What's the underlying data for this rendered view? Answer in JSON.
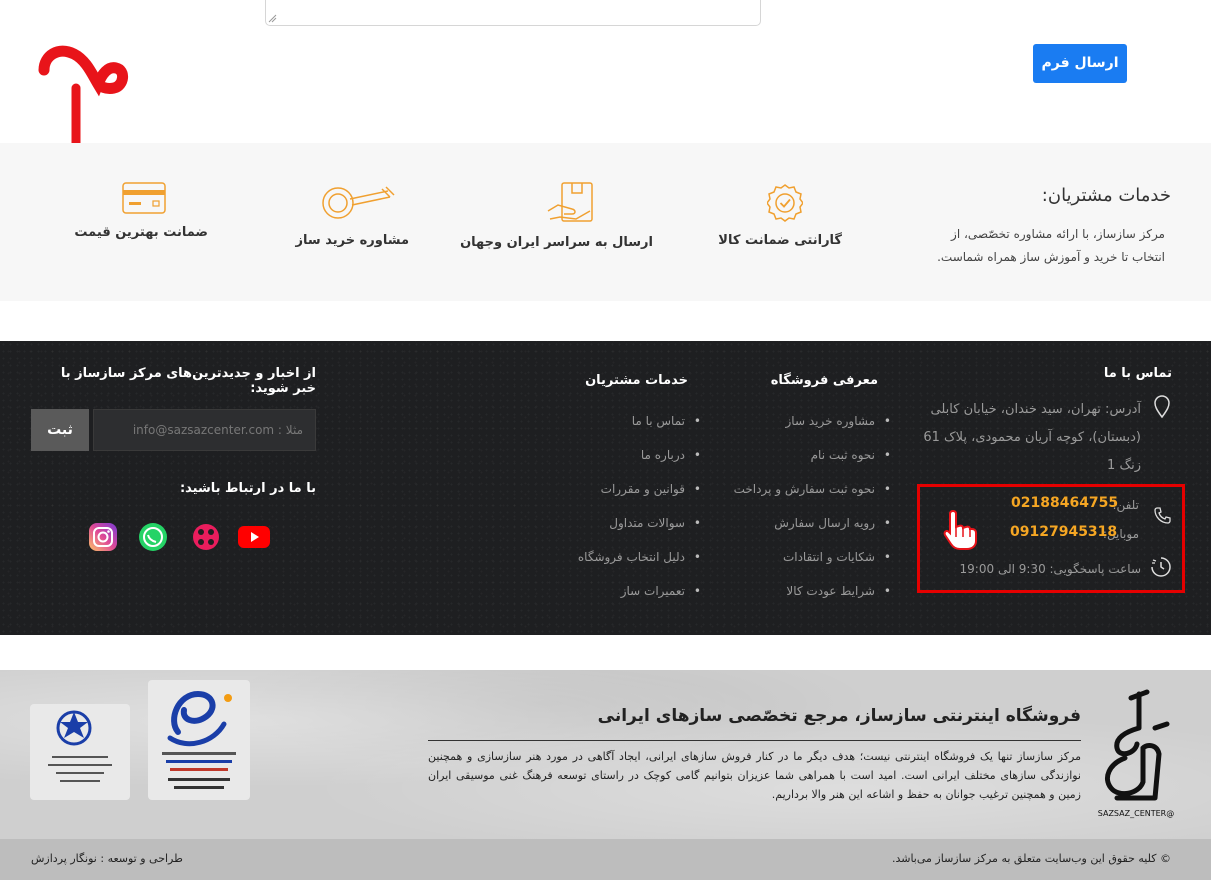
{
  "form": {
    "submit_label": "ارسال فرم",
    "step_number": "۴"
  },
  "services": {
    "title": "خدمات مشتریان:",
    "description": "مرکز سازساز، با ارائه مشاوره تخصّصی، از انتخاب تا خرید و آموزش ساز همراه شماست.",
    "items": [
      {
        "label": "گارانتی ضمانت کالا",
        "icon": "warranty-badge-icon"
      },
      {
        "label": "ارسال به سراسر ایران وجهان",
        "icon": "delivery-box-icon"
      },
      {
        "label": "مشاوره خرید ساز",
        "icon": "setar-instrument-icon"
      },
      {
        "label": "ضمانت بهترین قیمت",
        "icon": "credit-card-icon"
      }
    ],
    "accent_color": "#f0a030"
  },
  "footer": {
    "contact": {
      "title": "تماس با ما",
      "address": "آدرس: تهران، سید خندان، خیابان کابلی (دبستان)، کوچه آریان محمودی، پلاک 61 زنگ 1",
      "phone_label": "تلفن:",
      "phone": "02188464755",
      "mobile_label": "موبایل:",
      "mobile": "09127945318",
      "hours": "ساعت پاسخگویی: 9:30 الی 19:00"
    },
    "shop": {
      "title": "معرفی فروشگاه",
      "links": [
        "مشاوره خرید ساز",
        "نحوه ثبت نام",
        "نحوه ثبت سفارش و پرداخت",
        "رویه ارسال سفارش",
        "شکایات و انتقادات",
        "شرایط عودت کالا"
      ]
    },
    "customer": {
      "title": "خدمات مشتریان",
      "links": [
        "تماس با ما",
        "درباره ما",
        "قوانین و مقررات",
        "سوالات متداول",
        "دلیل انتخاب فروشگاه",
        "تعمیرات ساز"
      ]
    },
    "newsletter": {
      "title": "از اخبار و جدیدترین‌های مرکز سازساز با خبر شوید:",
      "placeholder": "مثلا : info@sazsazcenter.com",
      "button": "ثبت"
    },
    "social": {
      "title": "با ما در ارتباط باشید:",
      "icons": [
        "youtube-icon",
        "aparat-icon",
        "whatsapp-icon",
        "instagram-icon"
      ]
    }
  },
  "about": {
    "title": "فروشگاه اینترنتی سازساز، مرجع تخصّصی سازهای ایرانی",
    "text": "مرکز سازساز تنها یک فروشگاه اینترنتی نیست؛ هدف دیگر ما در کنار فروش سازهای ایرانی، ایجاد آگاهی در مورد هنر سازسازی و همچنین نوازندگی سازهای مختلف ایرانی است. امید است با همراهی شما عزیزان بتوانیم گامی کوچک در راستای توسعه فرهنگ غنی موسیقی ایران زمین و همچنین ترغیب جوانان به حفظ و اشاعه این هنر والا برداریم.",
    "logo_caption": "@SAZSAZ_CENTER"
  },
  "bottom": {
    "copyright": "© کلیه حقوق این وب‌سایت متعلق به مرکز سازساز می‌باشد.",
    "designer": "طراحی و توسعه : نونگار پردازش"
  }
}
